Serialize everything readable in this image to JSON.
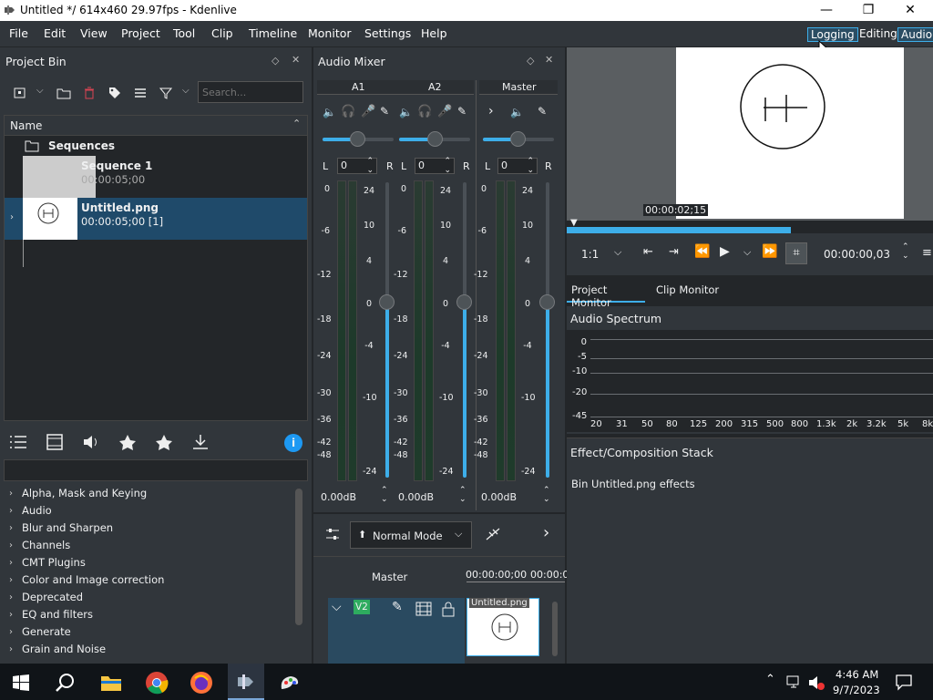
{
  "window": {
    "title": "Untitled */ 614x460 29.97fps - Kdenlive",
    "minimize": "—",
    "restore": "❐",
    "close": "✕"
  },
  "menu": [
    "File",
    "Edit",
    "View",
    "Project",
    "Tool",
    "Clip",
    "Timeline",
    "Monitor",
    "Settings",
    "Help"
  ],
  "workspaces": [
    "Logging",
    "Editing",
    "Audio"
  ],
  "project_bin": {
    "title": "Project Bin",
    "search_placeholder": "Search...",
    "column": "Name",
    "folder": "Sequences",
    "items": [
      {
        "name": "Sequence 1",
        "meta": "00:00:05;00"
      },
      {
        "name": "Untitled.png",
        "meta": "00:00:05;00 [1]"
      }
    ]
  },
  "audio_mixer": {
    "title": "Audio Mixer",
    "channels": [
      {
        "name": "A1",
        "gain": "0",
        "db": "0.00dB"
      },
      {
        "name": "A2",
        "gain": "0",
        "db": "0.00dB"
      },
      {
        "name": "Master",
        "gain": "0",
        "db": "0.00dB"
      }
    ],
    "pan_left": "L",
    "pan_right": "R",
    "left_scale": [
      "0",
      "-6",
      "-12",
      "-18",
      "-24",
      "-30",
      "-36",
      "-42",
      "-48"
    ],
    "right_scale": [
      "24",
      "10",
      "4",
      "0",
      "-4",
      "-10",
      "-24"
    ]
  },
  "monitor": {
    "timecode_overlay": "00:00:02;15",
    "zoom": "1:1",
    "timecode": "00:00:00,03",
    "tabs": [
      "Project Monitor",
      "Clip Monitor"
    ]
  },
  "audio_spectrum": {
    "title": "Audio Spectrum",
    "y_ticks": [
      "0",
      "-5",
      "-10",
      "-20",
      "-45"
    ],
    "x_ticks": [
      "20",
      "31",
      "50",
      "80",
      "125",
      "200",
      "315",
      "500",
      "800",
      "1.3k",
      "2k",
      "3.2k",
      "5k",
      "8k"
    ]
  },
  "effect_stack": {
    "title": "Effect/Composition Stack",
    "text": "Bin Untitled.png effects"
  },
  "effects_list": [
    "Alpha, Mask and Keying",
    "Audio",
    "Blur and Sharpen",
    "Channels",
    "CMT Plugins",
    "Color and Image correction",
    "Deprecated",
    "EQ and filters",
    "Generate",
    "Grain and Noise"
  ],
  "timeline": {
    "mode": "Normal Mode",
    "master": "Master",
    "tc1": "00:00:00;00",
    "tc2": "00:00:0",
    "track": "V2",
    "clip": "Untitled.png"
  },
  "taskbar": {
    "time": "4:46 AM",
    "date": "9/7/2023"
  },
  "colors": {
    "accent": "#3daee9",
    "panel": "#31363b",
    "dark": "#232629"
  }
}
